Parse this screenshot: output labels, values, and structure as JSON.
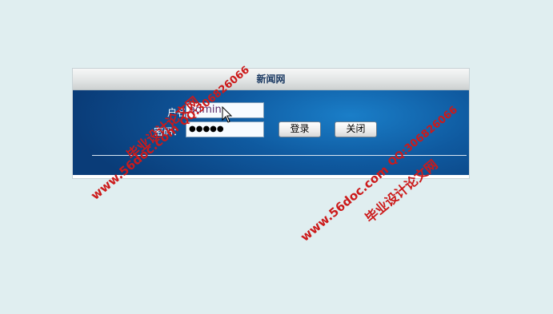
{
  "panel": {
    "title": "新闻网"
  },
  "form": {
    "username_label": "户名",
    "username_value": "admin",
    "password_label": "密码：",
    "password_value": "●●●●●",
    "login_button": "登录",
    "close_button": "关闭"
  },
  "watermarks": {
    "site_name": "毕业设计论文网",
    "url": "www.56doc.com",
    "qq": "QQ:306826066"
  },
  "colors": {
    "background": "#e0eef0",
    "panel_blue": "#0f5aa0",
    "watermark": "#cc1a1a"
  }
}
